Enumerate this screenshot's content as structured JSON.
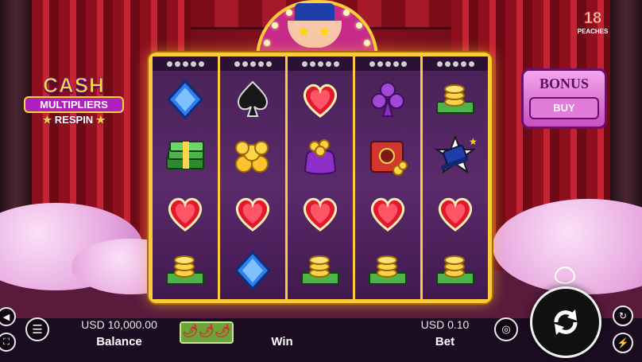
{
  "brand": {
    "number": "18",
    "name": "PEACHES"
  },
  "logo": {
    "line1": "CASH",
    "line2": "MULTIPLIERS",
    "line3": "RESPIN"
  },
  "bonus": {
    "title": "BONUS",
    "buy_label": "BUY"
  },
  "reels": [
    [
      "blue-diamond",
      "cash-stack",
      "red-heart",
      "cash-coins"
    ],
    [
      "black-spade",
      "gold-coins",
      "red-heart",
      "blue-diamond"
    ],
    [
      "red-heart",
      "money-bag",
      "red-heart",
      "cash-coins"
    ],
    [
      "purple-club",
      "treasure-safe",
      "red-heart",
      "cash-coins"
    ],
    [
      "cash-coins",
      "magician-hat",
      "red-heart",
      "cash-coins"
    ]
  ],
  "balance": {
    "value": "USD 10,000.00",
    "label": "Balance"
  },
  "win": {
    "label": "Win"
  },
  "bet": {
    "value": "USD 0.10",
    "label": "Bet"
  },
  "icons": {
    "sound": "speaker-icon",
    "menu": "hamburger-menu-icon",
    "fullscreen": "fullscreen-icon",
    "volatility": "chili-peppers-icon",
    "bet_chips": "coin-stack-icon",
    "spin": "spin-arrows-icon",
    "autoplay": "autoplay-icon",
    "turbo": "lightning-icon",
    "peach": "peach-icon"
  },
  "colors": {
    "frame": "#ffc93c",
    "reel_bg": "#4a2259",
    "bonus": "#e07cd8",
    "bar": "#1c0c22"
  }
}
